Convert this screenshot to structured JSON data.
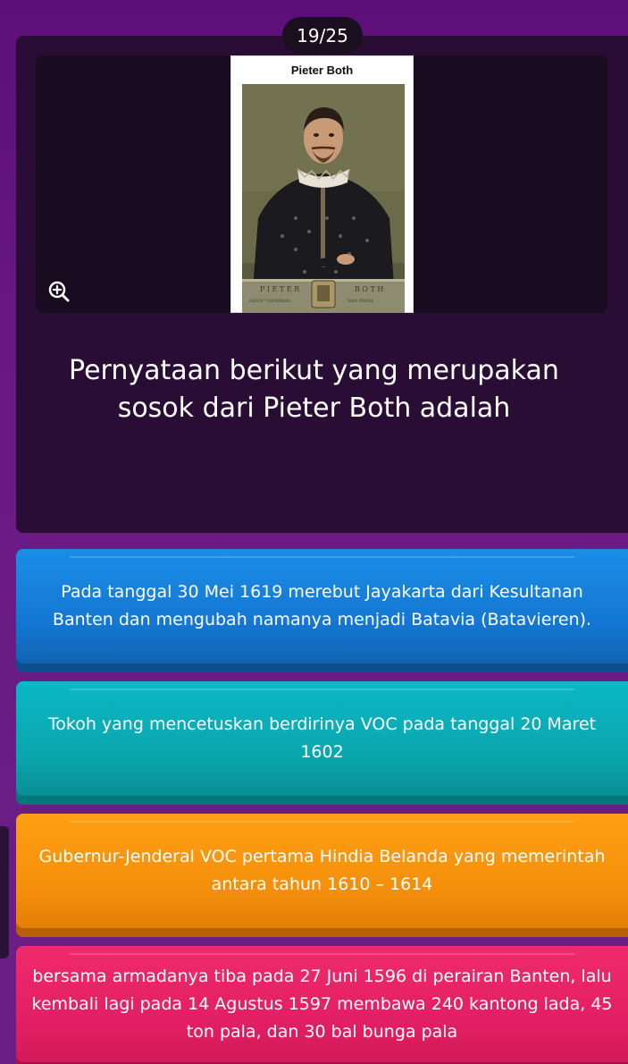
{
  "progress": {
    "label": "19/25"
  },
  "question": {
    "image_caption": "Pieter Both",
    "text": "Pernyataan berikut yang merupakan sosok dari Pieter Both adalah",
    "zoom_icon": "zoom-in-icon"
  },
  "options": [
    {
      "text": "Pada tanggal 30 Mei 1619 merebut Jayakarta dari Kesultanan Banten dan mengubah namanya menjadi Batavia (Batavieren).",
      "color": "#1477d4"
    },
    {
      "text": "Tokoh yang mencetuskan berdirinya VOC pada tanggal 20 Maret 1602",
      "color": "#0aa6ad"
    },
    {
      "text": "Gubernur-Jenderal VOC pertama Hindia Belanda yang memerintah antara tahun 1610 – 1614",
      "color": "#f58f0b"
    },
    {
      "text": "bersama armadanya tiba pada 27 Juni 1596 di perairan Banten, lalu kembali lagi pada 14 Agustus 1597 membawa 240 kantong lada, 45 ton pala, dan 30 bal bunga pala",
      "color": "#e21f62"
    }
  ],
  "colors": {
    "background": "#5c0f79",
    "card": "#2a0d35",
    "media_bg": "#1a0c20"
  }
}
